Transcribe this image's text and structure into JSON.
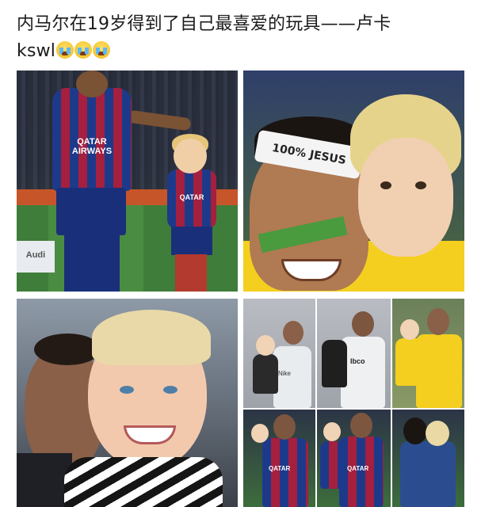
{
  "post": {
    "line1": "内马尔在19岁得到了自己最喜爱的玩具——卢卡",
    "line2": "kswl",
    "emojis": [
      "loudly-crying-face-emoji",
      "loudly-crying-face-emoji",
      "loudly-crying-face-emoji"
    ]
  },
  "photos": [
    {
      "name": "match-photo",
      "jersey_text": "QATAR AIRWAYS",
      "kid_jersey_text": "QATAR",
      "ad_text": "Audi"
    },
    {
      "name": "headband-photo",
      "headband_text": "100% JESUS"
    },
    {
      "name": "selfie-photo"
    },
    {
      "name": "collage-photo",
      "jersey_texts": [
        "Nike",
        "Ibco",
        "QATAR",
        "QATAR"
      ]
    }
  ],
  "colors": {
    "text": "#1b1b1b",
    "barca_blue": "#1d3a8a",
    "barca_red": "#a51f3f",
    "brazil_yellow": "#f4cf1f"
  }
}
